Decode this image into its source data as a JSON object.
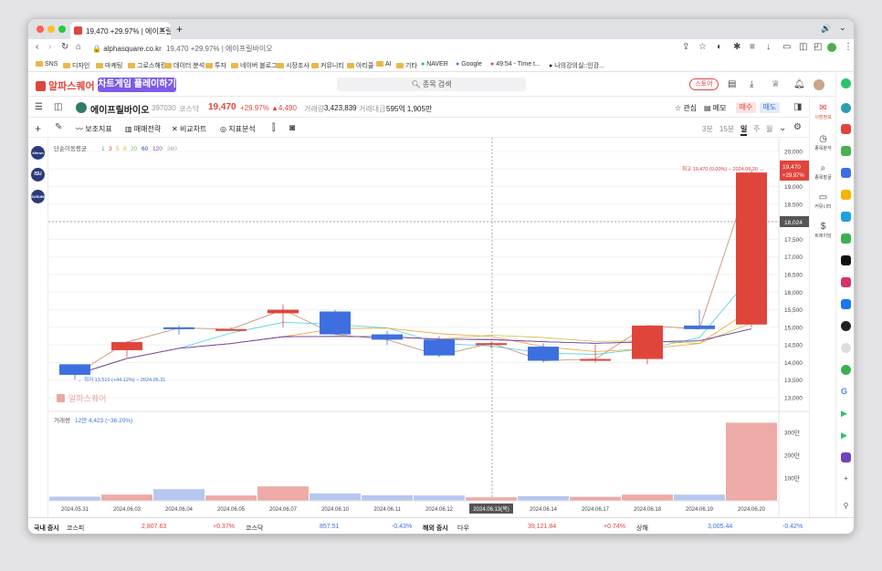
{
  "browser": {
    "tab_title": "19,470 +29.97% | 에이프릴바이",
    "url": "alphasquare.co.kr",
    "url_title": "19,470 +29.97% | 에이프릴바이오",
    "bookmarks": [
      "SNS",
      "디자인",
      "마케팅",
      "그로스해킹",
      "데이터 분석",
      "투자",
      "네이버 블로그",
      "시장조사",
      "커뮤니티",
      "아티클",
      "AI",
      "기타",
      "NAVER",
      "Google",
      "49:54 - Time t...",
      "나의강의실::인강..."
    ]
  },
  "app": {
    "logo": "알파스퀘어",
    "game_button": "차트게임 플레이하기",
    "search_placeholder": "종목 검색",
    "store_button": "스토어"
  },
  "stock": {
    "name": "에이프릴바이오",
    "code": "397030",
    "market": "코스닥",
    "price": "19,470",
    "change_pct": "+29.97%",
    "change_abs": "▲4,490",
    "volume_label": "거래량",
    "volume": "3,423,839",
    "amount_label": "거래대금",
    "amount": "595억 1,905만",
    "watch_label": "관심",
    "memo_label": "메모",
    "buy_label": "매수",
    "sell_label": "매도"
  },
  "toolbar": {
    "indicator": "보조지표",
    "strategy": "매매전략",
    "compare": "비교차트",
    "analysis": "지표분석",
    "periods": [
      "3분",
      "15분",
      "일",
      "주",
      "월"
    ],
    "active_period": "일"
  },
  "left_badges": [
    "4thrun",
    "ISU",
    "SUSUBIO"
  ],
  "chart_data": {
    "type": "candlestick",
    "ma_label": "단순이동평균",
    "ma_periods": [
      "1",
      "3",
      "5",
      "8",
      "20",
      "60",
      "120",
      "360"
    ],
    "dates": [
      "2024.05.31",
      "2024.06.03",
      "2024.06.04",
      "2024.06.05",
      "2024.06.07",
      "2024.06.10",
      "2024.06.11",
      "2024.06.12",
      "2024.06.13(목)",
      "2024.06.14",
      "2024.06.17",
      "2024.06.18",
      "2024.06.19",
      "2024.06.20"
    ],
    "ohlc": [
      [
        13950,
        13950,
        13510,
        13650
      ],
      [
        14350,
        14600,
        14150,
        14580
      ],
      [
        15000,
        15050,
        14800,
        14980
      ],
      [
        14900,
        15000,
        14950,
        14950
      ],
      [
        15400,
        15650,
        15000,
        15500
      ],
      [
        15450,
        15500,
        14800,
        14800
      ],
      [
        14800,
        14900,
        14500,
        14650
      ],
      [
        14650,
        14750,
        14150,
        14200
      ],
      [
        14500,
        14600,
        14400,
        14550
      ],
      [
        14450,
        14550,
        14000,
        14050
      ],
      [
        14050,
        14500,
        14000,
        14100
      ],
      [
        14100,
        15050,
        13950,
        15050
      ],
      [
        15050,
        15500,
        14950,
        14950
      ],
      [
        15080,
        19470,
        15000,
        19400
      ]
    ],
    "volume_label": "거래량",
    "volume_info": "12만 4,423 (−36.20%)",
    "volume": [
      180,
      270,
      510,
      230,
      630,
      320,
      240,
      230,
      150,
      200,
      170,
      270,
      270,
      3423
    ],
    "y_ticks": [
      "20,000",
      "19,500",
      "19,000",
      "18,500",
      "18,000",
      "17,500",
      "17,000",
      "16,500",
      "16,000",
      "15,500",
      "15,000",
      "14,500",
      "14,000",
      "13,500",
      "13,000"
    ],
    "ylim": [
      13000,
      20000
    ],
    "vol_ticks": [
      "300만",
      "200만",
      "100만"
    ],
    "high_annotation": "최고 19,470 (0.00%) − 2024.06.20 →",
    "low_annotation": "← 최저 13,510 (+44.12%) − 2024.05.31",
    "price_tag": "19,470",
    "price_tag_pct": "+29.97%",
    "crosshair_value": "18,024",
    "watermark": "알파스퀘어"
  },
  "right_sidebar": [
    "시장정보",
    "종목분석",
    "종목발굴",
    "커뮤니티",
    "트레이딩"
  ],
  "bottom": {
    "domestic_label": "국내 증시",
    "kospi_label": "코스피",
    "kospi": "2,807.63",
    "kospi_chg": "+0.37%",
    "kosdaq_label": "코스닥",
    "kosdaq": "857.51",
    "kosdaq_chg": "-0.43%",
    "foreign_label": "해외 증시",
    "dow_label": "다우",
    "dow": "39,121.84",
    "dow_chg": "+0.74%",
    "shanghai_label": "상해",
    "shanghai": "3,005.44",
    "shanghai_chg": "-0.42%"
  },
  "colors": {
    "up": "#e0453c",
    "down": "#3d6fe0",
    "brand": "#7c5ce6"
  }
}
